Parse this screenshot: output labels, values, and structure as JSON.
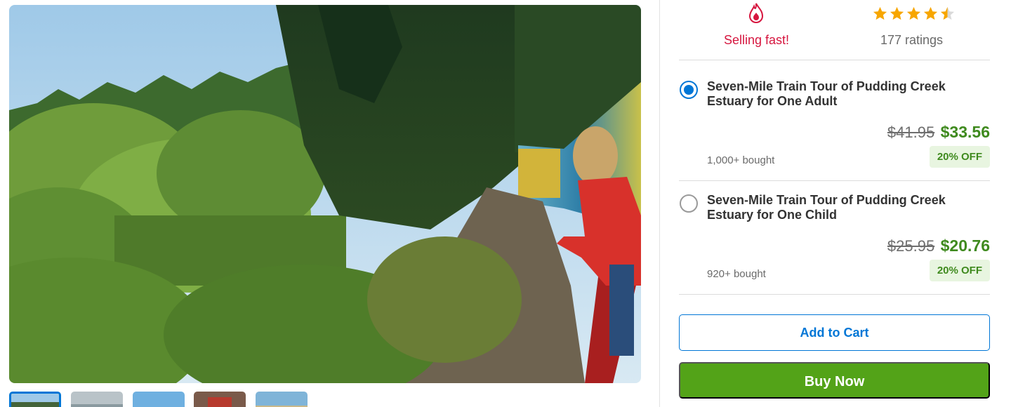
{
  "gallery": {
    "hero_alt": "Train ride through forest",
    "thumbnail_count": 5,
    "active_thumbnail": 1
  },
  "stats": {
    "selling_label": "Selling fast!",
    "ratings_label": "177 ratings",
    "rating_value": 4.5,
    "selling_icon": "fire-icon",
    "star_color": "#f7a600"
  },
  "options": [
    {
      "title": "Seven-Mile Train Tour of Pudding Creek Estuary for One Adult",
      "old_price": "$41.95",
      "new_price": "$33.56",
      "bought": "1,000+ bought",
      "discount": "20% OFF",
      "selected": true
    },
    {
      "title": "Seven-Mile Train Tour of Pudding Creek Estuary for One Child",
      "old_price": "$25.95",
      "new_price": "$20.76",
      "bought": "920+ bought",
      "discount": "20% OFF",
      "selected": false
    }
  ],
  "actions": {
    "add_to_cart": "Add to Cart",
    "buy_now": "Buy Now"
  },
  "colors": {
    "accent_blue": "#0076d6",
    "price_green": "#3f8a1e",
    "buy_green": "#53a318",
    "selling_red": "#d6163f"
  }
}
